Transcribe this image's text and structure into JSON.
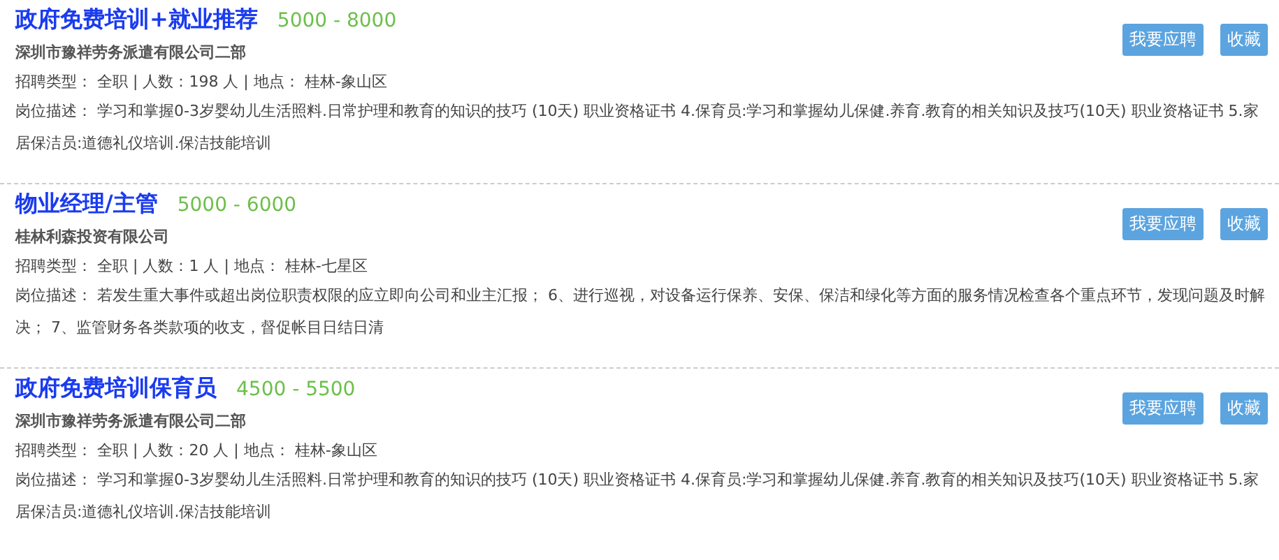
{
  "jobs": [
    {
      "title": "政府免费培训+就业推荐",
      "salary": "5000 - 8000",
      "company": "深圳市豫祥劳务派遣有限公司二部",
      "meta": "招聘类型： 全职 | 人数：198 人 | 地点： 桂林-象山区",
      "description": "岗位描述： 学习和掌握0-3岁婴幼儿生活照料.日常护理和教育的知识的技巧 (10天) 职业资格证书 4.保育员:学习和掌握幼儿保健.养育.教育的相关知识及技巧(10天) 职业资格证书 5.家居保洁员:道德礼仪培训.保洁技能培训",
      "buttons": [
        "我要应聘",
        "收藏"
      ]
    },
    {
      "title": "物业经理/主管",
      "salary": "5000 - 6000",
      "company": "桂林利森投资有限公司",
      "meta": "招聘类型： 全职 | 人数：1 人 | 地点： 桂林-七星区",
      "description": "岗位描述： 若发生重大事件或超出岗位职责权限的应立即向公司和业主汇报； 6、进行巡视，对设备运行保养、安保、保洁和绿化等方面的服务情况检查各个重点环节，发现问题及时解决； 7、监管财务各类款项的收支，督促帐目日结日清",
      "buttons": [
        "我要应聘",
        "收藏"
      ]
    },
    {
      "title": "政府免费培训保育员",
      "salary": "4500 - 5500",
      "company": "深圳市豫祥劳务派遣有限公司二部",
      "meta": "招聘类型： 全职 | 人数：20 人 | 地点： 桂林-象山区",
      "description": "岗位描述： 学习和掌握0-3岁婴幼儿生活照料.日常护理和教育的知识的技巧 (10天) 职业资格证书 4.保育员:学习和掌握幼儿保健.养育.教育的相关知识及技巧(10天) 职业资格证书 5.家居保洁员:道德礼仪培训.保洁技能培训",
      "buttons": [
        "我要应聘",
        "收藏"
      ]
    }
  ]
}
